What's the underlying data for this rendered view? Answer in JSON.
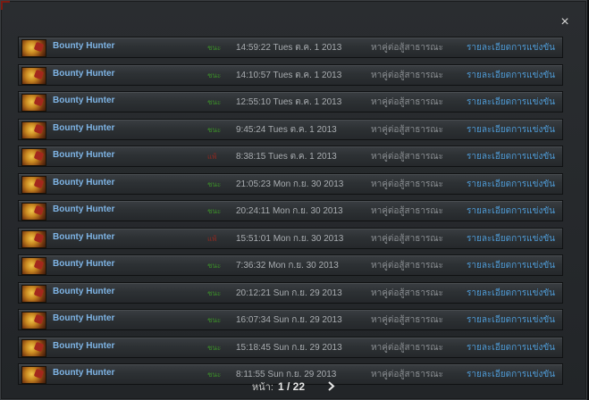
{
  "dialog": {
    "close_label": "×"
  },
  "rows": [
    {
      "hero": "Bounty Hunter",
      "result": "ชนะ",
      "result_type": "win",
      "datetime": "14:59:22 Tues ต.ค. 1 2013",
      "lobby": "หาคู่ต่อสู้สาธารณะ",
      "details": "รายละเอียดการแข่งขัน"
    },
    {
      "hero": "Bounty Hunter",
      "result": "ชนะ",
      "result_type": "win",
      "datetime": "14:10:57 Tues ต.ค. 1 2013",
      "lobby": "หาคู่ต่อสู้สาธารณะ",
      "details": "รายละเอียดการแข่งขัน"
    },
    {
      "hero": "Bounty Hunter",
      "result": "ชนะ",
      "result_type": "win",
      "datetime": "12:55:10 Tues ต.ค. 1 2013",
      "lobby": "หาคู่ต่อสู้สาธารณะ",
      "details": "รายละเอียดการแข่งขัน"
    },
    {
      "hero": "Bounty Hunter",
      "result": "ชนะ",
      "result_type": "win",
      "datetime": "9:45:24 Tues ต.ค. 1 2013",
      "lobby": "หาคู่ต่อสู้สาธารณะ",
      "details": "รายละเอียดการแข่งขัน"
    },
    {
      "hero": "Bounty Hunter",
      "result": "แพ้",
      "result_type": "loss",
      "datetime": "8:38:15 Tues ต.ค. 1 2013",
      "lobby": "หาคู่ต่อสู้สาธารณะ",
      "details": "รายละเอียดการแข่งขัน"
    },
    {
      "hero": "Bounty Hunter",
      "result": "ชนะ",
      "result_type": "win",
      "datetime": "21:05:23 Mon ก.ย. 30 2013",
      "lobby": "หาคู่ต่อสู้สาธารณะ",
      "details": "รายละเอียดการแข่งขัน"
    },
    {
      "hero": "Bounty Hunter",
      "result": "ชนะ",
      "result_type": "win",
      "datetime": "20:24:11 Mon ก.ย. 30 2013",
      "lobby": "หาคู่ต่อสู้สาธารณะ",
      "details": "รายละเอียดการแข่งขัน"
    },
    {
      "hero": "Bounty Hunter",
      "result": "แพ้",
      "result_type": "loss",
      "datetime": "15:51:01 Mon ก.ย. 30 2013",
      "lobby": "หาคู่ต่อสู้สาธารณะ",
      "details": "รายละเอียดการแข่งขัน"
    },
    {
      "hero": "Bounty Hunter",
      "result": "ชนะ",
      "result_type": "win",
      "datetime": "7:36:32 Mon ก.ย. 30 2013",
      "lobby": "หาคู่ต่อสู้สาธารณะ",
      "details": "รายละเอียดการแข่งขัน"
    },
    {
      "hero": "Bounty Hunter",
      "result": "ชนะ",
      "result_type": "win",
      "datetime": "20:12:21 Sun ก.ย. 29 2013",
      "lobby": "หาคู่ต่อสู้สาธารณะ",
      "details": "รายละเอียดการแข่งขัน"
    },
    {
      "hero": "Bounty Hunter",
      "result": "ชนะ",
      "result_type": "win",
      "datetime": "16:07:34 Sun ก.ย. 29 2013",
      "lobby": "หาคู่ต่อสู้สาธารณะ",
      "details": "รายละเอียดการแข่งขัน"
    },
    {
      "hero": "Bounty Hunter",
      "result": "ชนะ",
      "result_type": "win",
      "datetime": "15:18:45 Sun ก.ย. 29 2013",
      "lobby": "หาคู่ต่อสู้สาธารณะ",
      "details": "รายละเอียดการแข่งขัน"
    },
    {
      "hero": "Bounty Hunter",
      "result": "ชนะ",
      "result_type": "win",
      "datetime": "8:11:55 Sun ก.ย. 29 2013",
      "lobby": "หาคู่ต่อสู้สาธารณะ",
      "details": "รายละเอียดการแข่งขัน"
    }
  ],
  "pager": {
    "label": "หน้า:",
    "current": "1 / 22",
    "next_icon": "chevron-right-icon"
  },
  "colors": {
    "hero_name": "#7fb5e6",
    "win": "#3c8e2a",
    "loss": "#8e2a22",
    "details_link": "#4f9bd6"
  }
}
